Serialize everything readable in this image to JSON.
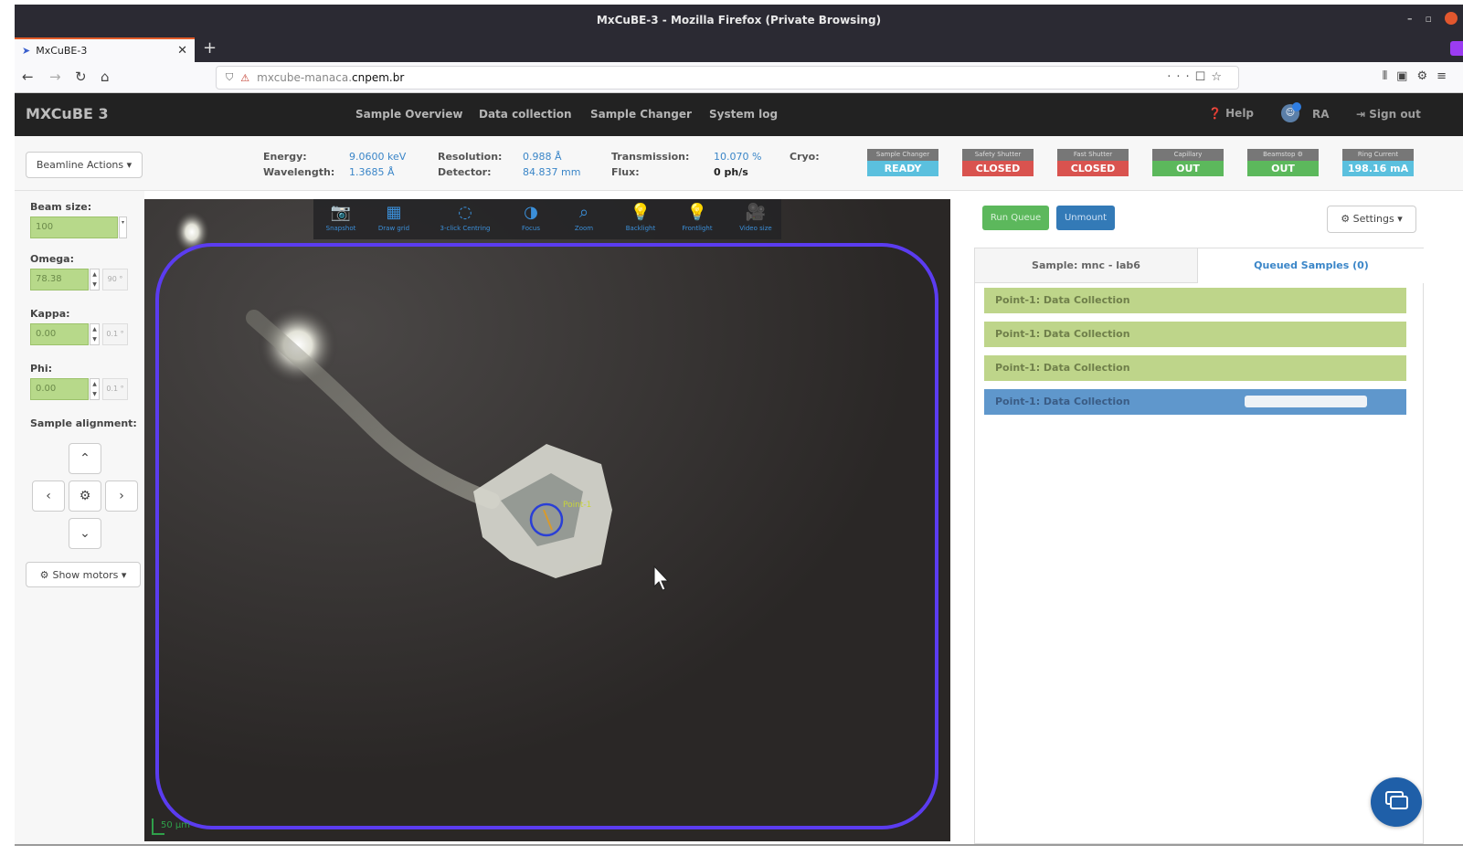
{
  "window": {
    "title": "MxCuBE-3 - Mozilla Firefox (Private Browsing)",
    "tab_title": "MxCuBE-3",
    "url_prefix": "mxcube-manaca.",
    "url_domain": "cnpem.br"
  },
  "header": {
    "brand": "MXCuBE 3",
    "menu": [
      "Sample Overview",
      "Data collection",
      "Sample Changer",
      "System log"
    ],
    "help": "Help",
    "user": "RA",
    "sign_out": "Sign out"
  },
  "status": {
    "beamline_actions": "Beamline Actions ▾",
    "energy_label": "Energy:",
    "energy_value": "9.0600 keV",
    "wavelength_label": "Wavelength:",
    "wavelength_value": "1.3685 Å",
    "resolution_label": "Resolution:",
    "resolution_value": "0.988 Å",
    "detector_label": "Detector:",
    "detector_value": "84.837 mm",
    "transmission_label": "Transmission:",
    "transmission_value": "10.070 %",
    "flux_label": "Flux:",
    "flux_value": "0 ph/s",
    "cryo_label": "Cryo:",
    "hardware": [
      {
        "label": "Sample Changer",
        "value": "READY",
        "color": "#5bc0de"
      },
      {
        "label": "Safety Shutter",
        "value": "CLOSED",
        "color": "#d9534f"
      },
      {
        "label": "Fast Shutter",
        "value": "CLOSED",
        "color": "#d9534f"
      },
      {
        "label": "Capillary",
        "value": "OUT",
        "color": "#5cb85c"
      },
      {
        "label": "Beamstop ⚙",
        "value": "OUT",
        "color": "#5cb85c"
      },
      {
        "label": "Ring Current",
        "value": "198.16 mA",
        "color": "#5bc0de"
      }
    ]
  },
  "motors": {
    "beam_size_label": "Beam size:",
    "beam_size_value": "100",
    "omega_label": "Omega:",
    "omega_value": "78.38",
    "omega_step": "90 °",
    "kappa_label": "Kappa:",
    "kappa_value": "0.00",
    "kappa_step": "0.1 °",
    "phi_label": "Phi:",
    "phi_value": "0.00",
    "phi_step": "0.1 °",
    "sample_alignment_label": "Sample alignment:",
    "show_motors": "Show motors ▾"
  },
  "camera": {
    "tools": [
      "Snapshot",
      "Draw grid",
      "3-click Centring",
      "Focus",
      "Zoom",
      "Backlight",
      "Frontlight",
      "Video size"
    ],
    "point_label": "Point-1",
    "scale_label": "50 µm"
  },
  "queue": {
    "run_queue": "Run Queue",
    "unmount": "Unmount",
    "settings": "Settings ▾",
    "tab_sample": "Sample: mnc - lab6",
    "tab_queued": "Queued Samples (0)",
    "items": [
      "Point-1: Data Collection",
      "Point-1: Data Collection",
      "Point-1: Data Collection",
      "Point-1: Data Collection"
    ],
    "active_item_index": 3
  },
  "colors": {
    "accent_blue": "#3b86c8",
    "queue_green": "#bed58a",
    "queue_active": "#5f97cc",
    "roi_outline": "#5b3cf0"
  }
}
